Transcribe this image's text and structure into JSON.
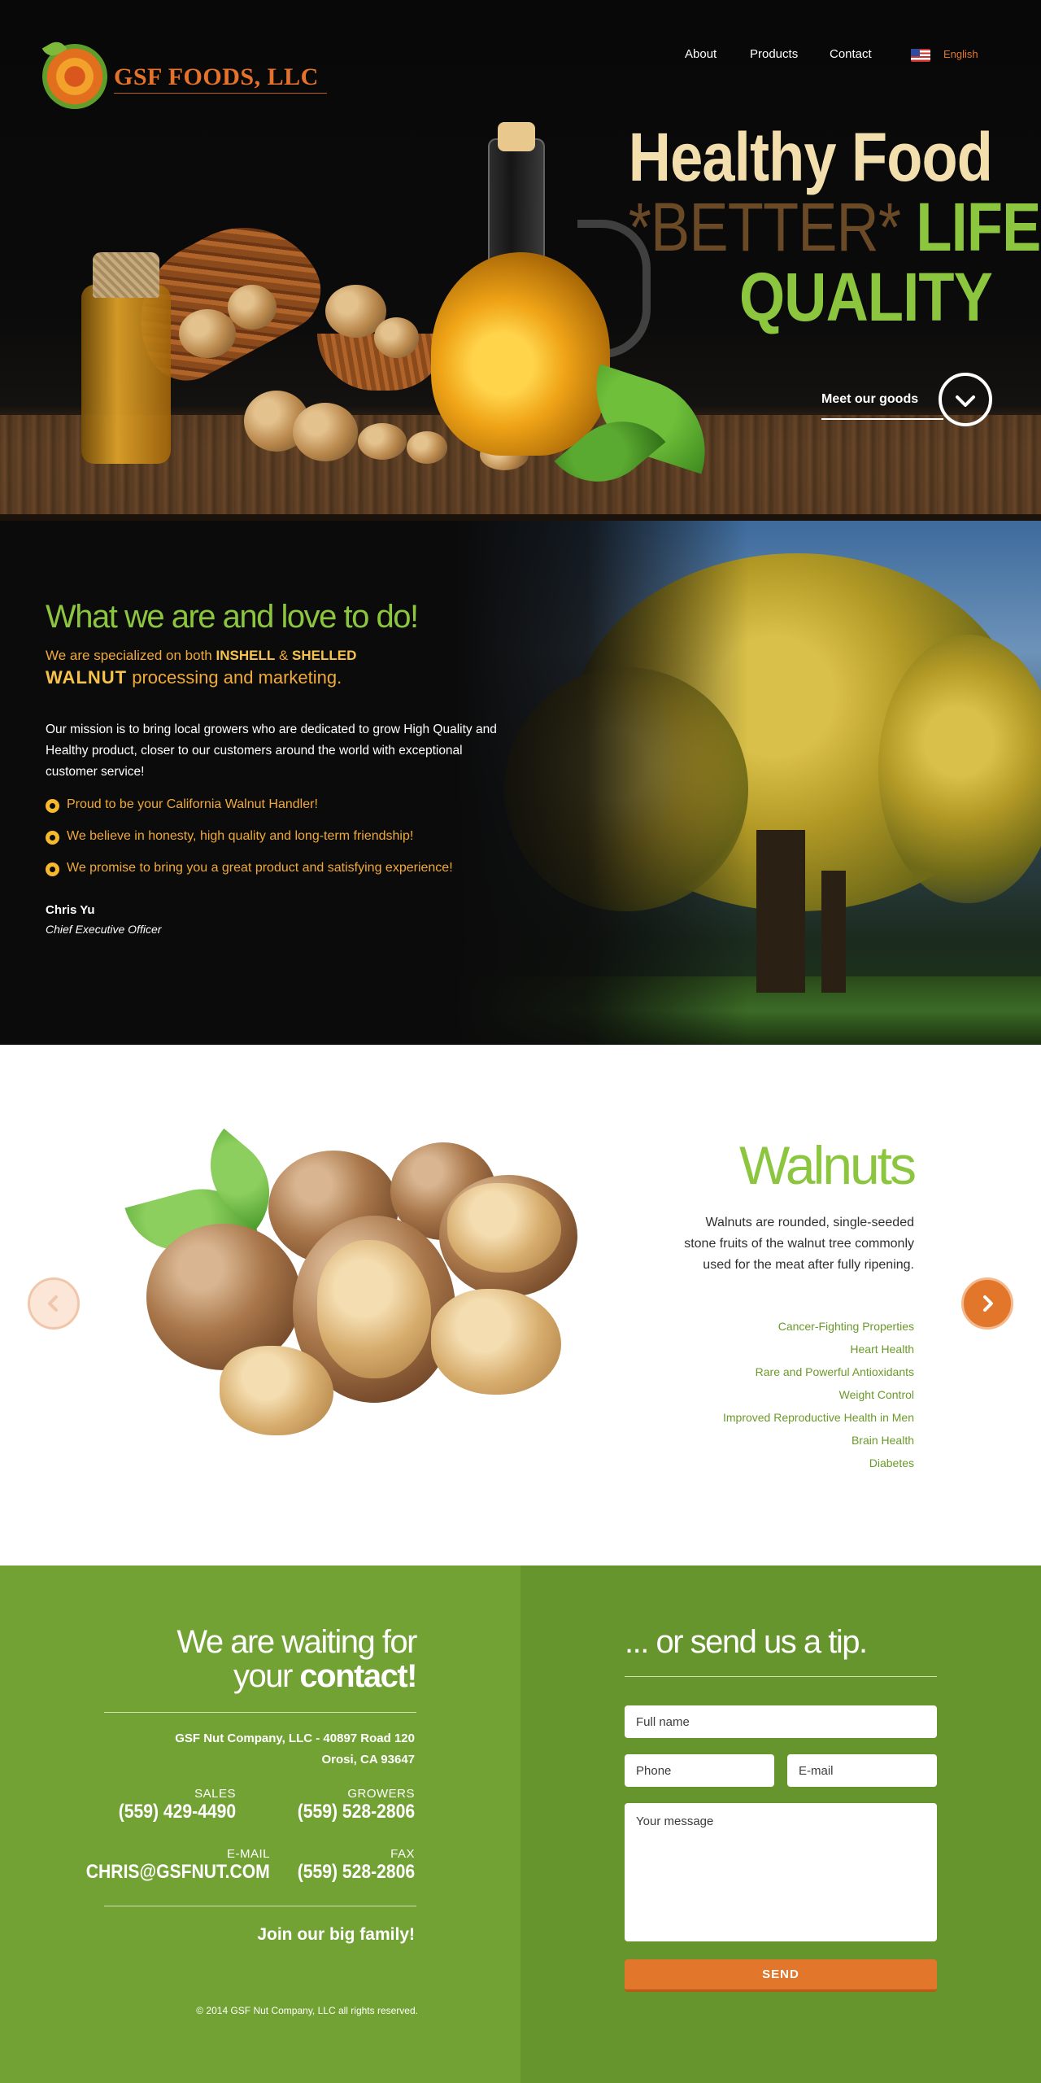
{
  "header": {
    "brand": "GSF FOODS, LLC",
    "nav": [
      {
        "label": "About"
      },
      {
        "label": "Products"
      },
      {
        "label": "Contact"
      }
    ],
    "language": "English"
  },
  "hero": {
    "line1": "Healthy Food",
    "better": "*BETTER*",
    "life": "LIFE",
    "line3": "QUALITY",
    "cta_label": "Meet our goods"
  },
  "about": {
    "title": "What we are and love to do!",
    "lead_prefix": "We are specialized on both",
    "lead_inshell": "INSHELL",
    "lead_amp": "&",
    "lead_shelled": "SHELLED",
    "lead_walnut": "WALNUT",
    "lead_suffix": "processing and marketing.",
    "mission": "Our mission is to bring local growers who are dedicated to grow High Quality and Healthy product, closer to our customers around the world with exceptional customer service!",
    "bullets": [
      "Proud to be your California Walnut Handler!",
      "We believe in honesty, high quality and long-term friendship!",
      "We promise to bring you a great product and satisfying experience!"
    ],
    "signature_name": "Chris Yu",
    "signature_title": "Chief Executive Officer"
  },
  "product": {
    "name": "Walnuts",
    "description": "Walnuts are rounded, single-seeded stone fruits of the walnut tree commonly used for the meat after fully ripening.",
    "benefits": [
      "Cancer-Fighting Properties",
      "Heart Health",
      "Rare and Powerful Antioxidants",
      "Weight Control",
      "Improved Reproductive Health in Men",
      "Brain Health",
      "Diabetes"
    ]
  },
  "contact": {
    "title_line1": "We are waiting for",
    "title_line2_prefix": "your",
    "title_line2_bold": "contact",
    "title_line2_suffix": "!",
    "address_line1": "GSF Nut Company, LLC - 40897 Road 120",
    "address_line2": "Orosi, CA 93647",
    "sales_label": "SALES",
    "sales_value": "(559) 429-4490",
    "growers_label": "GROWERS",
    "growers_value": "(559) 528-2806",
    "email_label": "E-MAIL",
    "email_value": "CHRIS@GSFNUT.COM",
    "fax_label": "FAX",
    "fax_value": "(559) 528-2806",
    "join": "Join our big family!",
    "copyright": "© 2014 GSF Nut Company, LLC all rights reserved."
  },
  "tip_form": {
    "title": "... or send us a tip.",
    "fullname_placeholder": "Full name",
    "phone_placeholder": "Phone",
    "email_placeholder": "E-mail",
    "message_placeholder": "Your message",
    "send_label": "SEND"
  },
  "colors": {
    "accent_green": "#8cc63f",
    "accent_orange": "#e2762a",
    "gold": "#f0a93a",
    "contact_green": "#73a234"
  }
}
